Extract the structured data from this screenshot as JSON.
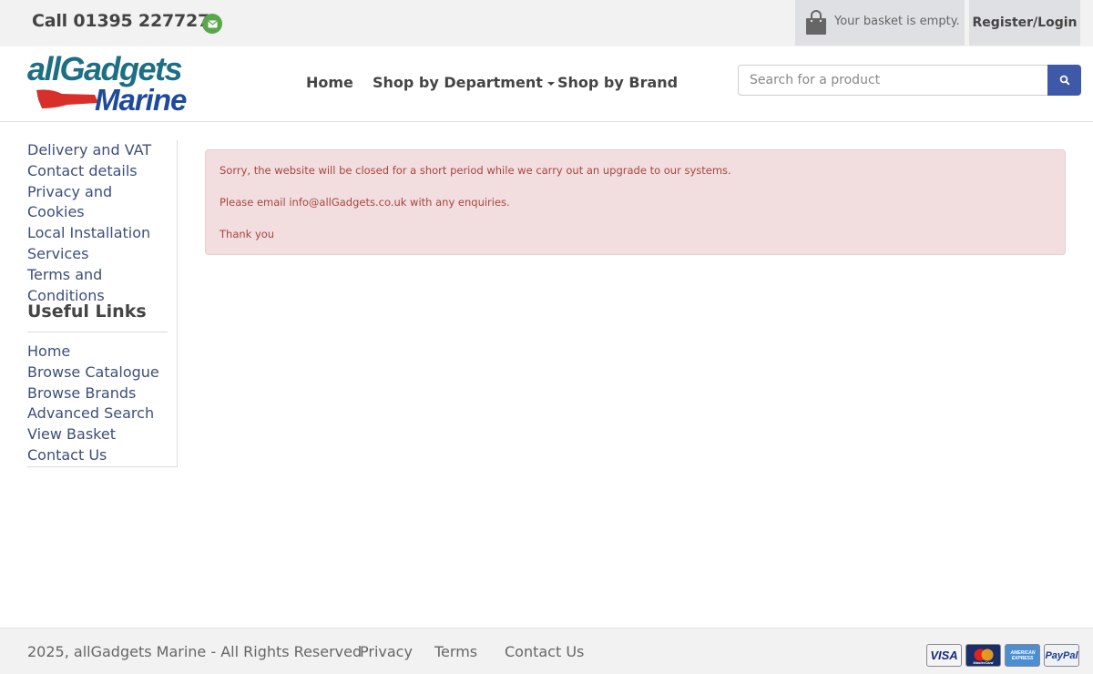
{
  "topbar": {
    "phone": "Call 01395 227727",
    "basket_text": "Your basket is empty.",
    "register_label": "Register/Login"
  },
  "logo": {
    "line1": "allGadgets",
    "line2": "Marine"
  },
  "nav": {
    "home": "Home",
    "department": "Shop by Department",
    "brand": "Shop by Brand"
  },
  "search": {
    "placeholder": "Search for a product"
  },
  "sidebar": {
    "top_links": [
      "Delivery and VAT",
      "Contact details",
      "Privacy and Cookies",
      "Local Installation Services",
      "Terms and Conditions"
    ],
    "useful_title": "Useful Links",
    "useful_links": [
      "Home",
      "Browse Catalogue",
      "Browse Brands",
      "Advanced Search",
      "View Basket",
      "Contact Us"
    ]
  },
  "alert": {
    "line1": "Sorry, the website will be closed for a short period while we carry out an upgrade to our systems.",
    "line2": "Please email info@allGadgets.co.uk with any enquiries.",
    "line3": "Thank you"
  },
  "footer": {
    "copyright": "2025, allGadgets Marine - All Rights Reserved",
    "privacy": "Privacy",
    "terms": "Terms",
    "contact": "Contact Us",
    "cards": [
      "VISA",
      "MasterCard",
      "AMERICAN EXPRESS",
      "PayPal"
    ]
  },
  "colors": {
    "accent_blue": "#3d59a8",
    "link": "#3c4e7a",
    "alert_bg": "#f2dede",
    "alert_text": "#a94442",
    "mail_green": "#5aa64a"
  }
}
